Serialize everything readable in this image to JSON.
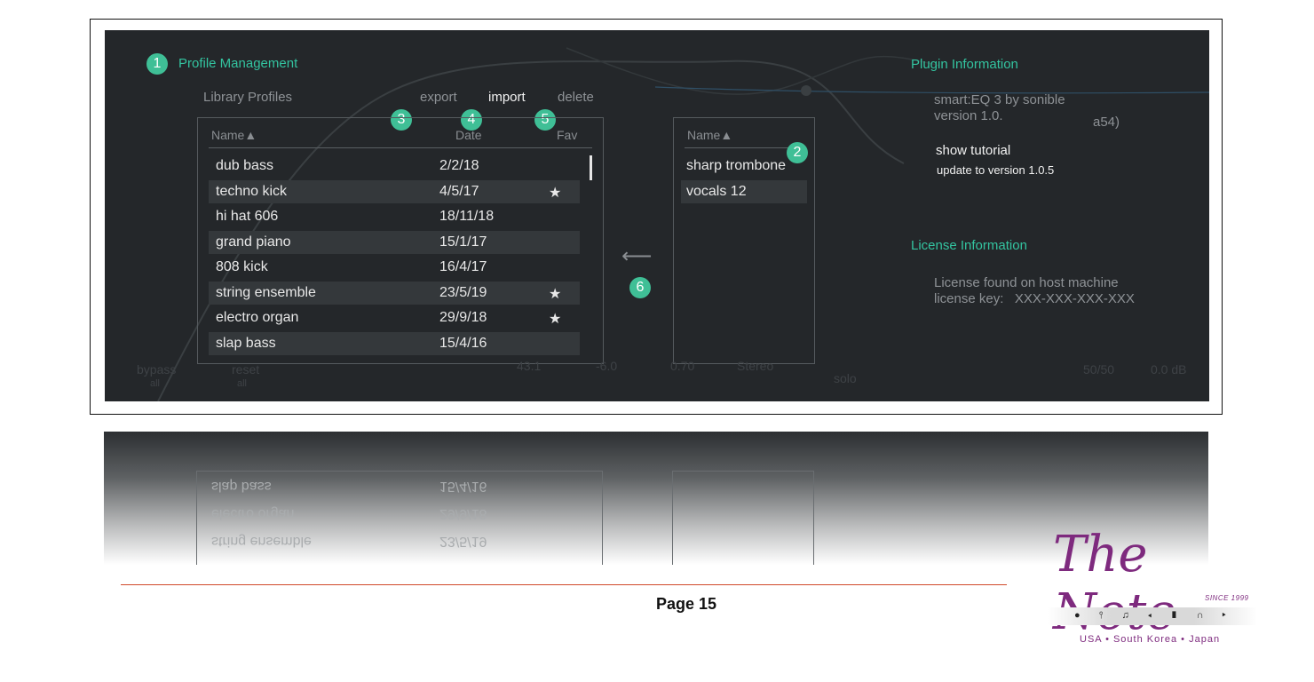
{
  "profile_management": {
    "title": "Profile Management",
    "badge": "1",
    "library_profiles_label": "Library Profiles",
    "actions": {
      "export": "export",
      "import": "import",
      "delete": "delete"
    },
    "badges": {
      "export": "3",
      "date": "4",
      "fav": "5",
      "right_list": "2",
      "arrow": "6"
    },
    "library_table": {
      "columns": [
        "Name▲",
        "Date",
        "Fav"
      ],
      "rows": [
        {
          "name": "dub bass",
          "date": "2/2/18",
          "fav": ""
        },
        {
          "name": "techno kick",
          "date": "4/5/17",
          "fav": "★"
        },
        {
          "name": "hi hat 606",
          "date": "18/11/18",
          "fav": ""
        },
        {
          "name": "grand piano",
          "date": "15/1/17",
          "fav": ""
        },
        {
          "name": "808 kick",
          "date": "16/4/17",
          "fav": ""
        },
        {
          "name": "string ensemble",
          "date": "23/5/19",
          "fav": "★"
        },
        {
          "name": "electro organ",
          "date": "29/9/18",
          "fav": "★"
        },
        {
          "name": "slap bass",
          "date": "15/4/16",
          "fav": ""
        }
      ]
    },
    "arrow_glyph": "⟵",
    "plugin_table": {
      "columns": [
        "Name▲"
      ],
      "rows": [
        "sharp trombone",
        "vocals 12"
      ]
    }
  },
  "plugin_information": {
    "title": "Plugin Information",
    "line1": "smart:EQ 3 by sonible",
    "line2": "version 1.0.",
    "build_suffix": "a54)",
    "show_tutorial": "show tutorial",
    "update": "update to version 1.0.5"
  },
  "license_information": {
    "title": "License Information",
    "line1": "License found on host machine",
    "line2": "license key:   XXX-XXX-XXX-XXX"
  },
  "footer_controls": {
    "bypass": "bypass",
    "bypass_sub": "all",
    "reset": "reset",
    "reset_sub": "all",
    "v1": "43.1",
    "v2": "-6.0",
    "v3": "0.70",
    "v4": "Stereo",
    "solo": "solo",
    "v5": "50/50",
    "v6": "0.0 dB"
  },
  "page": {
    "number": "Page 15"
  },
  "logo": {
    "name": "The Note",
    "since": "SINCE 1999",
    "icons": "● ⫯ ♫ ◂ ▮ ∩ ▸",
    "tagline": "USA • South Korea • Japan"
  },
  "colors": {
    "accent": "#33c4a0",
    "panel": "#24272a",
    "logo": "#7e2a7e",
    "rule": "#d04a2a"
  }
}
